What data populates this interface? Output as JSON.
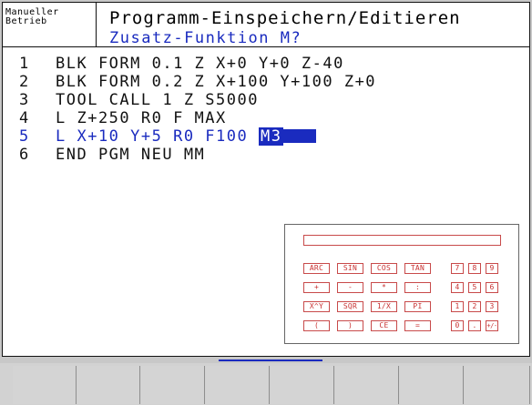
{
  "header": {
    "mode_line1": "Manueller",
    "mode_line2": "Betrieb",
    "title": "Programm-Einspeichern/Editieren",
    "subtitle": "Zusatz-Funktion M?"
  },
  "program": {
    "lines": [
      {
        "num": "1",
        "text": "BLK FORM 0.1 Z X+0 Y+0 Z-40"
      },
      {
        "num": "2",
        "text": "BLK FORM 0.2 Z X+100 Y+100 Z+0"
      },
      {
        "num": "3",
        "text": "TOOL CALL 1 Z S5000"
      },
      {
        "num": "4",
        "text": "L Z+250 R0 F MAX"
      },
      {
        "num": "5",
        "text": "L X+10 Y+5 R0 F100 ",
        "cursor": "M3"
      },
      {
        "num": "6",
        "text": "END PGM NEU MM"
      }
    ]
  },
  "calculator": {
    "display_value": "",
    "func_keys": [
      [
        "ARC",
        "SIN",
        "COS",
        "TAN"
      ],
      [
        "+",
        "-",
        "*",
        ":"
      ],
      [
        "X^Y",
        "SQR",
        "1/X",
        "PI"
      ],
      [
        "(",
        ")",
        "CE",
        "="
      ]
    ],
    "digit_keys": [
      [
        "7",
        "8",
        "9"
      ],
      [
        "4",
        "5",
        "6"
      ],
      [
        "1",
        "2",
        "3"
      ],
      [
        "0",
        ".",
        "+/-"
      ]
    ]
  },
  "softkeys": [
    "",
    "",
    "",
    "",
    "",
    "",
    "",
    ""
  ],
  "colors": {
    "accent_blue": "#1a2bbf",
    "calc_red": "#c83232"
  }
}
